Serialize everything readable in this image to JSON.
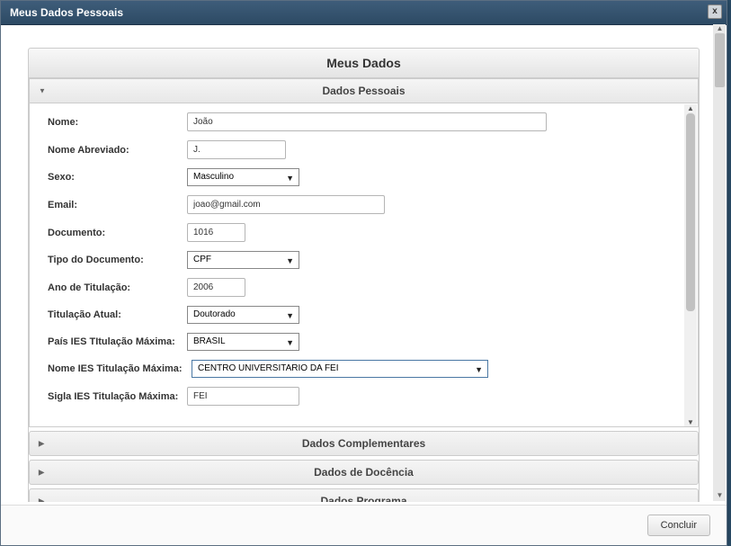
{
  "modal": {
    "title": "Meus Dados Pessoais",
    "close_icon": "x"
  },
  "card": {
    "title": "Meus Dados"
  },
  "accordion": {
    "pessoais": {
      "label": "Dados Pessoais",
      "arrow_open": "▼",
      "arrow_closed": "▶"
    },
    "complementares": {
      "label": "Dados Complementares"
    },
    "docencia": {
      "label": "Dados de Docência"
    },
    "programa": {
      "label": "Dados Programa"
    }
  },
  "fields": {
    "nome": {
      "label": "Nome:",
      "value": "João"
    },
    "nome_abreviado": {
      "label": "Nome Abreviado:",
      "value": "J."
    },
    "sexo": {
      "label": "Sexo:",
      "value": "Masculino"
    },
    "email": {
      "label": "Email:",
      "value": "joao@gmail.com"
    },
    "documento": {
      "label": "Documento:",
      "value": "1016"
    },
    "tipo_documento": {
      "label": "Tipo do Documento:",
      "value": "CPF"
    },
    "ano_titulacao": {
      "label": "Ano de Titulação:",
      "value": "2006"
    },
    "titulacao_atual": {
      "label": "Titulação Atual:",
      "value": "Doutorado"
    },
    "pais_ies": {
      "label": "País IES TItulação Máxima:",
      "value": "BRASIL"
    },
    "nome_ies": {
      "label": "Nome IES Titulação Máxima:",
      "value": "CENTRO UNIVERSITARIO DA FEI"
    },
    "sigla_ies": {
      "label": "Sigla IES Titulação Máxima:",
      "value": "FEI"
    }
  },
  "footer": {
    "concluir": "Concluir"
  }
}
